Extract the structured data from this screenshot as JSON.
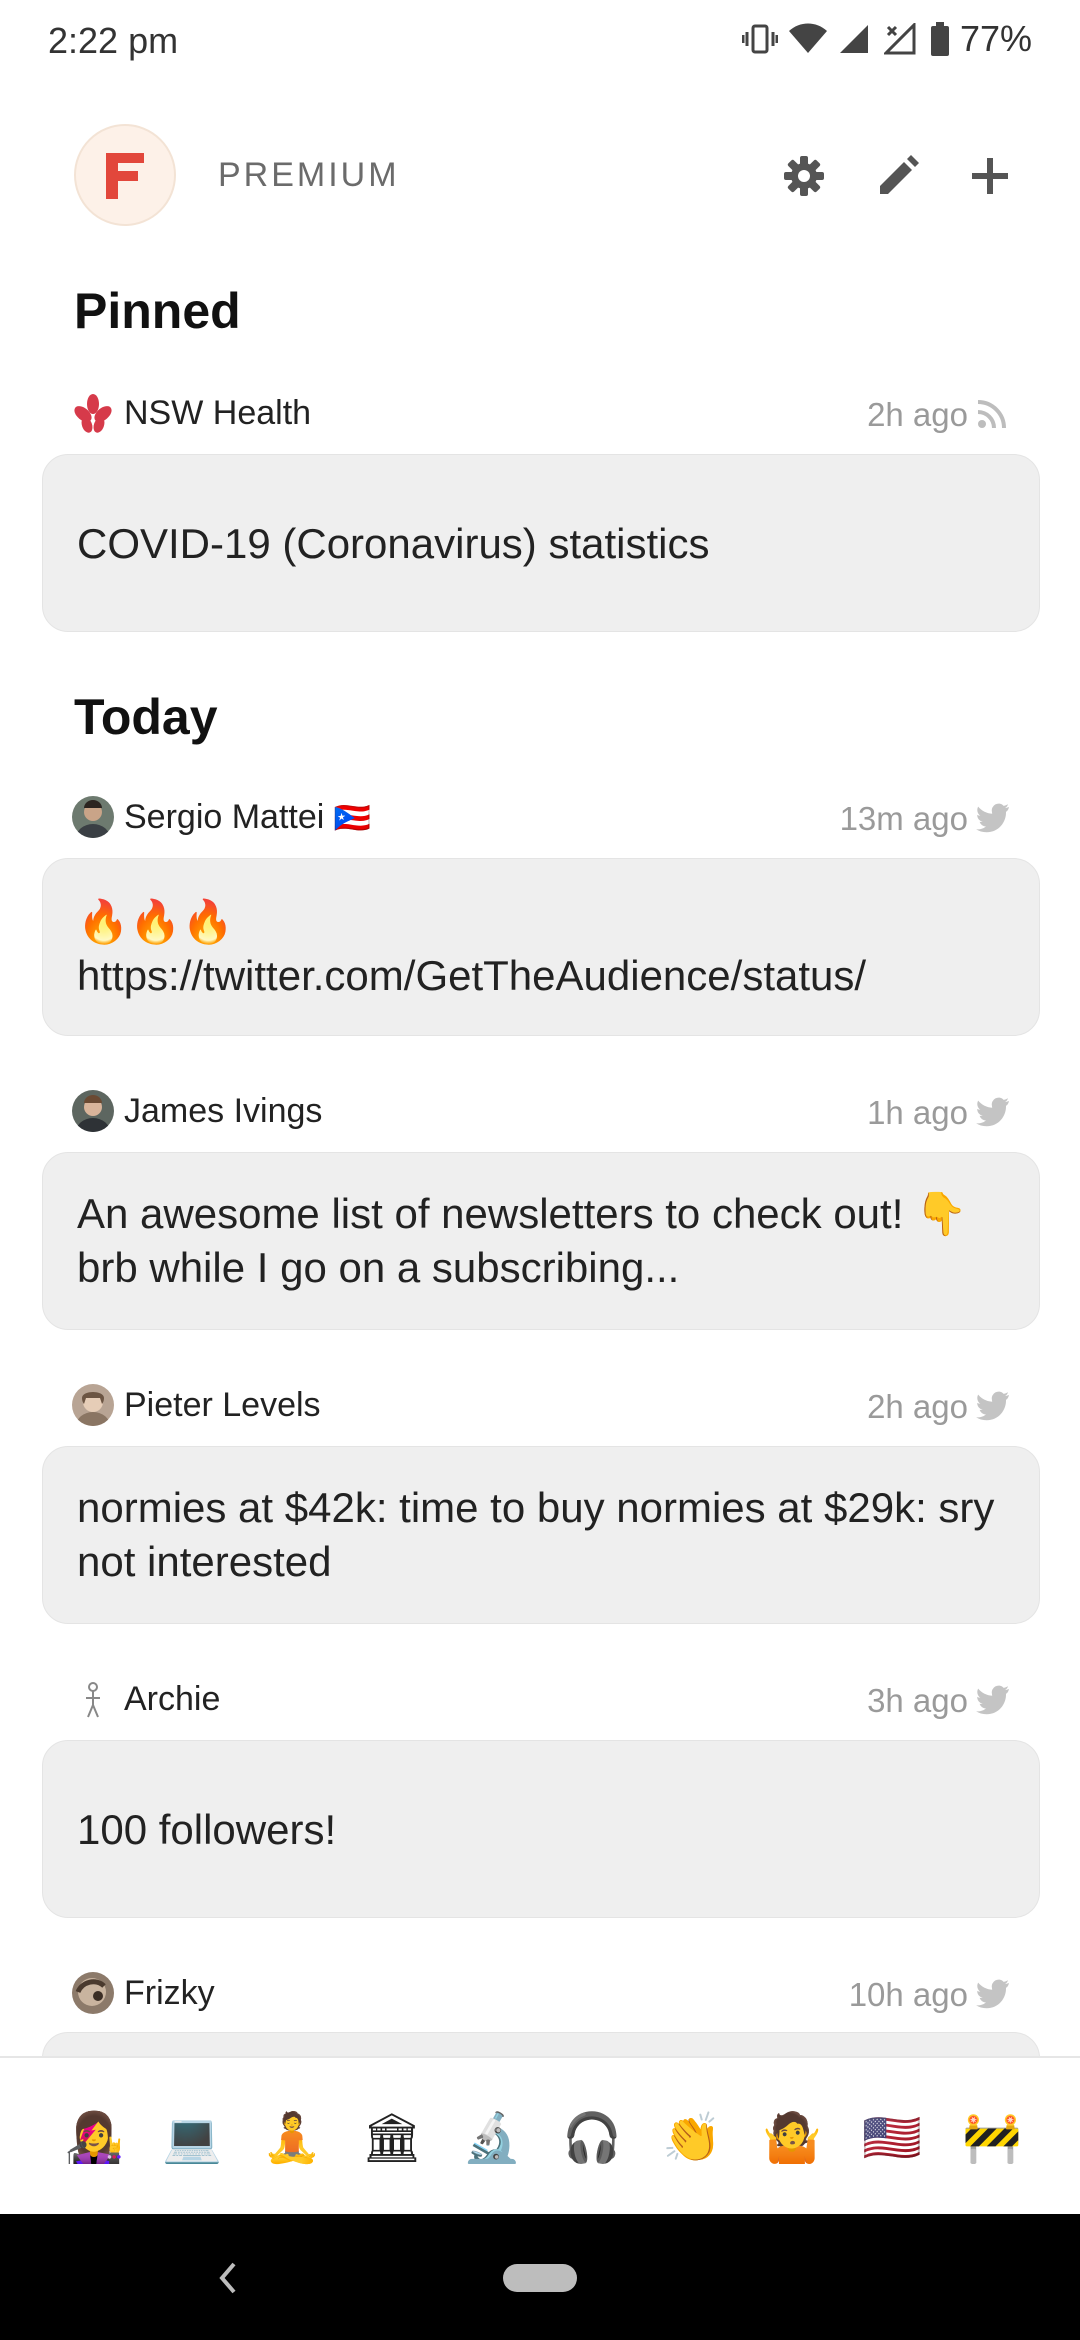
{
  "status_bar": {
    "time": "2:22 pm",
    "battery": "77%"
  },
  "header": {
    "logo_letter": "F",
    "plan": "PREMIUM"
  },
  "sections": {
    "pinned_title": "Pinned",
    "today_title": "Today"
  },
  "pinned": [
    {
      "source": "NSW Health",
      "time": "2h ago",
      "type": "rss",
      "text": "COVID-19 (Coronavirus) statistics"
    }
  ],
  "today": [
    {
      "source": "Sergio Mattei",
      "flag": "🇵🇷",
      "time": "13m ago",
      "type": "twitter",
      "text": "🔥🔥🔥\nhttps://twitter.com/GetTheAudience/status/"
    },
    {
      "source": "James Ivings",
      "time": "1h ago",
      "type": "twitter",
      "text": "An awesome list of newsletters to check out! 👇 brb while I go on a subscribing..."
    },
    {
      "source": "Pieter Levels",
      "time": "2h ago",
      "type": "twitter",
      "text": "normies at $42k: time to buy normies at $29k: sry not interested"
    },
    {
      "source": "Archie",
      "time": "3h ago",
      "type": "twitter",
      "text": "100 followers!"
    },
    {
      "source": "Frizky",
      "time": "10h ago",
      "type": "twitter",
      "text": ""
    }
  ],
  "bottom_nav": [
    {
      "name": "woman-technologist",
      "glyph": "👩‍🎤"
    },
    {
      "name": "laptop",
      "glyph": "💻"
    },
    {
      "name": "person-in-lotus-position",
      "glyph": "🧘"
    },
    {
      "name": "classical-building",
      "glyph": "🏛"
    },
    {
      "name": "microscope",
      "glyph": "🔬"
    },
    {
      "name": "headphone",
      "glyph": "🎧"
    },
    {
      "name": "clapping-hands",
      "glyph": "👏"
    },
    {
      "name": "person-shrugging",
      "glyph": "🤷"
    },
    {
      "name": "us-flag",
      "glyph": "🇺🇸"
    },
    {
      "name": "construction",
      "glyph": "🚧"
    }
  ],
  "colors": {
    "accent": "#e2473b",
    "card_bg": "#efefef",
    "muted_text": "#9a9a9a",
    "icon_gray": "#555555"
  }
}
